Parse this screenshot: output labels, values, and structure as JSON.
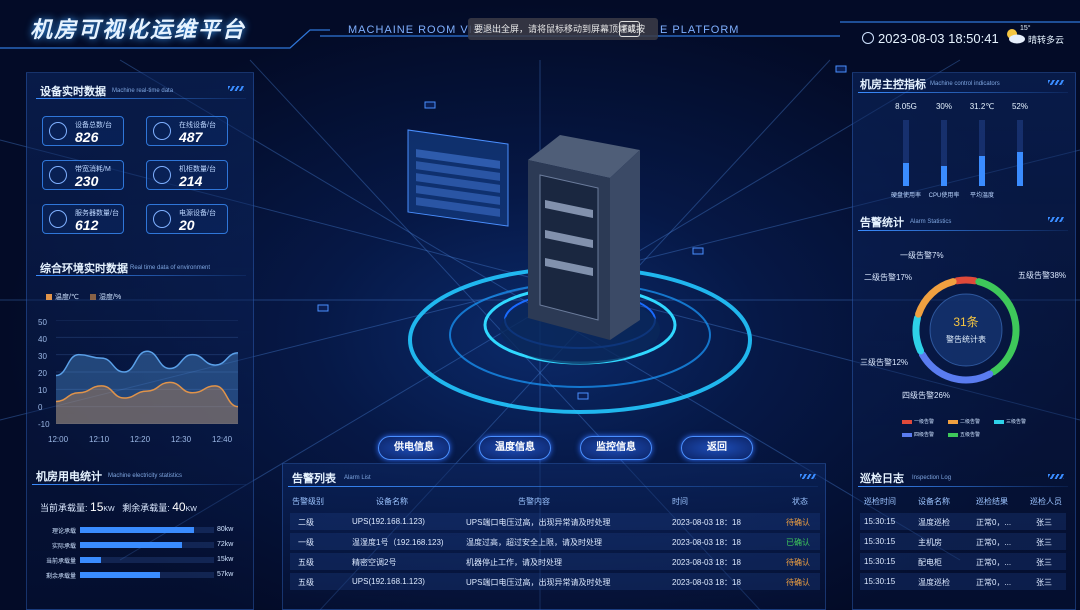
{
  "header": {
    "title": "机房可视化运维平台",
    "subtitle": "MACHAINE ROOM VISUALI",
    "subtitle_tail": "E PLATFORM",
    "toast_text": "要退出全屏，请将鼠标移动到屏幕顶端或按",
    "toast_key": "F11",
    "datetime": "2023-08-03  18:50:41",
    "temperature": "15°",
    "weather": "晴转多云"
  },
  "device": {
    "title": "设备实时数据",
    "en": "Machine real-time data",
    "cards": [
      {
        "label": "设备总数/台",
        "value": "826",
        "icon": "device-icon"
      },
      {
        "label": "在线设备/台",
        "value": "487",
        "icon": "online-icon"
      },
      {
        "label": "带宽消耗/M",
        "value": "230",
        "icon": "bandwidth-icon"
      },
      {
        "label": "机柜数量/台",
        "value": "214",
        "icon": "cabinet-icon"
      },
      {
        "label": "服务器数量/台",
        "value": "612",
        "icon": "server-icon"
      },
      {
        "label": "电源设备/台",
        "value": "20",
        "icon": "power-icon"
      }
    ]
  },
  "env": {
    "title": "综合环境实时数据",
    "en": "Real time data of environment",
    "legend": [
      "温度/℃",
      "湿度/%"
    ],
    "yticks": [
      "50",
      "40",
      "30",
      "20",
      "10",
      "0",
      "-10"
    ],
    "xticks": [
      "12:00",
      "12:10",
      "12:20",
      "12:30",
      "12:40"
    ]
  },
  "chart_data": {
    "type": "area",
    "x": [
      "12:00",
      "12:05",
      "12:10",
      "12:15",
      "12:20",
      "12:25",
      "12:30",
      "12:35",
      "12:40"
    ],
    "ylim": [
      -10,
      50
    ],
    "series": [
      {
        "name": "温度/℃",
        "color": "#e0934a",
        "values": [
          3,
          8,
          12,
          5,
          9,
          14,
          8,
          12,
          0
        ]
      },
      {
        "name": "湿度/%",
        "color": "#5aa0e8",
        "values": [
          18,
          30,
          28,
          20,
          32,
          22,
          30,
          24,
          31
        ]
      }
    ]
  },
  "electric": {
    "title": "机房用电统计",
    "en": "Machine electricity statistics",
    "current_label": "当前承载量:",
    "current_value": "15",
    "remain_label": "剩余承载量:",
    "remain_value": "40",
    "unit": "KW",
    "bars": [
      {
        "label": "理论承载",
        "value": "80kw",
        "fraction": 0.85
      },
      {
        "label": "实际承载",
        "value": "72kw",
        "fraction": 0.76
      },
      {
        "label": "当前承载量",
        "value": "15kw",
        "fraction": 0.16
      },
      {
        "label": "剩余承载量",
        "value": "57kw",
        "fraction": 0.6
      }
    ]
  },
  "buttons": [
    "供电信息",
    "温度信息",
    "监控信息",
    "返回"
  ],
  "alarm_list": {
    "title": "告警列表",
    "en": "Alarm List",
    "headers": [
      "告警级别",
      "设备名称",
      "告警内容",
      "时间",
      "状态"
    ],
    "rows": [
      [
        "二级",
        "UPS(192.168.1.123)",
        "UPS端口电压过高，出现异常请及时处理",
        "2023-08-03  18：18",
        "待确认"
      ],
      [
        "一级",
        "温湿度1号（192.168.123)",
        "温度过高，超过安全上限，请及时处理",
        "2023-08-03  18：18",
        "已确认"
      ],
      [
        "五级",
        "精密空调2号",
        "机器停止工作，请及时处理",
        "2023-08-03  18：18",
        "待确认"
      ],
      [
        "五级",
        "UPS(192.168.1.123)",
        "UPS端口电压过高，出现异常请及时处理",
        "2023-08-03  18：18",
        "待确认"
      ]
    ]
  },
  "indicators": {
    "title": "机房主控指标",
    "en": "Machine control indicators",
    "items": [
      {
        "value": "8.05G",
        "label": "硬盘使用率",
        "fraction": 0.35
      },
      {
        "value": "30%",
        "label": "CPU使用率",
        "fraction": 0.3
      },
      {
        "value": "31.2℃",
        "label": "平均温度",
        "fraction": 0.45
      },
      {
        "value": "52%",
        "label": "",
        "fraction": 0.52
      }
    ]
  },
  "alarm_stats": {
    "title": "告警统计",
    "en": "Alarm Statistics",
    "count": "31条",
    "center_label": "警告统计表",
    "labels": [
      "一级告警7%",
      "二级告警17%",
      "五级告警38%",
      "三级告警12%",
      "四级告警26%"
    ],
    "legend": [
      "一级告警",
      "二级告警",
      "三级告警",
      "四级告警",
      "五级告警"
    ]
  },
  "donut_data": {
    "type": "pie",
    "categories": [
      "一级告警",
      "二级告警",
      "三级告警",
      "四级告警",
      "五级告警"
    ],
    "values": [
      7,
      17,
      12,
      26,
      38
    ],
    "colors": [
      "#e04a3a",
      "#f0a040",
      "#2ed1e8",
      "#5a7cf0",
      "#3ec85a"
    ]
  },
  "inspection": {
    "title": "巡检日志",
    "en": "Inspection Log",
    "headers": [
      "巡检时间",
      "设备名称",
      "巡检结果",
      "巡检人员"
    ],
    "rows": [
      [
        "15:30:15",
        "温度巡检",
        "正常0，...",
        "张三"
      ],
      [
        "15:30:15",
        "主机房",
        "正常0，...",
        "张三"
      ],
      [
        "15:30:15",
        "配电柜",
        "正常0，...",
        "张三"
      ],
      [
        "15:30:15",
        "温度巡检",
        "正常0，...",
        "张三"
      ]
    ]
  },
  "floating": {
    "rows": [
      "",
      "",
      "",
      "",
      "",
      ""
    ]
  }
}
